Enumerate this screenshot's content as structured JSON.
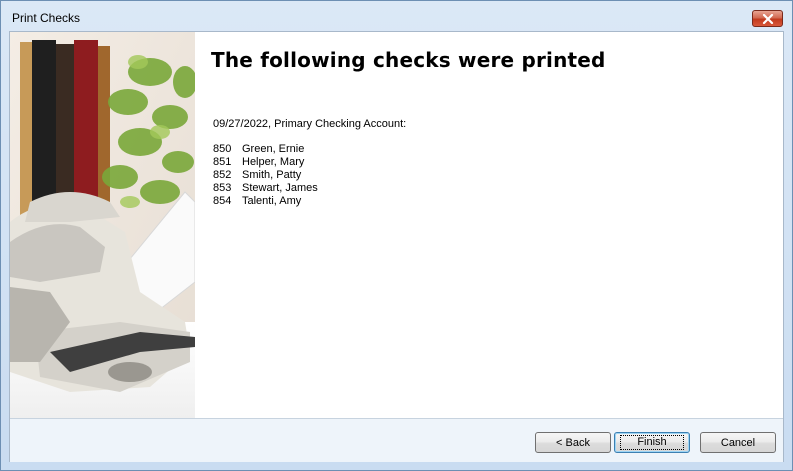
{
  "window": {
    "title": "Print Checks",
    "close_icon": "close-icon"
  },
  "sidebar_image": {
    "subject": "printer-with-plant-image"
  },
  "main": {
    "heading": "The following checks were printed",
    "summary": "09/27/2022, Primary Checking Account:",
    "checks": [
      {
        "number": "850",
        "payee": "Green, Ernie"
      },
      {
        "number": "851",
        "payee": "Helper, Mary"
      },
      {
        "number": "852",
        "payee": "Smith, Patty"
      },
      {
        "number": "853",
        "payee": "Stewart, James"
      },
      {
        "number": "854",
        "payee": "Talenti, Amy"
      }
    ]
  },
  "buttons": {
    "back": "< Back",
    "finish": "Finish",
    "cancel": "Cancel"
  },
  "colors": {
    "frame": "#c9dcf1",
    "footer": "#eef4fa",
    "close_button": "#c23a1e"
  }
}
